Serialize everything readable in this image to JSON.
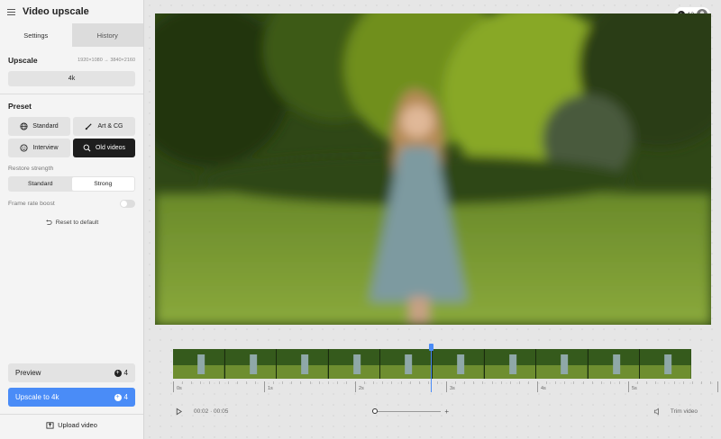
{
  "app": {
    "title": "Video upscale"
  },
  "tabs": [
    {
      "label": "Settings",
      "active": true
    },
    {
      "label": "History",
      "active": false
    }
  ],
  "upscale": {
    "label": "Upscale",
    "resolution": "1920×1080 → 3840×2160",
    "value": "4k"
  },
  "preset": {
    "label": "Preset",
    "options": [
      {
        "label": "Standard",
        "icon": "globe-icon",
        "selected": false
      },
      {
        "label": "Art & CG",
        "icon": "brush-icon",
        "selected": false
      },
      {
        "label": "Interview",
        "icon": "smile-icon",
        "selected": false
      },
      {
        "label": "Old videos",
        "icon": "magnifier-icon",
        "selected": true
      }
    ]
  },
  "restore": {
    "label": "Restore strength",
    "options": [
      "Standard",
      "Strong"
    ],
    "selected": "Standard"
  },
  "frame_rate": {
    "label": "Frame rate boost",
    "enabled": false
  },
  "reset": {
    "label": "Reset to default"
  },
  "actions": {
    "preview_label": "Preview",
    "preview_cost": "4",
    "upscale_label": "Upscale to 4k",
    "upscale_cost": "4",
    "upload_label": "Upload video"
  },
  "credits": {
    "count": "12"
  },
  "timeline": {
    "ticks": [
      "0s",
      "1s",
      "2s",
      "3s",
      "4s",
      "5s"
    ],
    "time_display": "00:02 · 00:05",
    "trim_label": "Trim video"
  },
  "colors": {
    "accent": "#4a8cf7",
    "selected_preset": "#1e1e1e"
  }
}
